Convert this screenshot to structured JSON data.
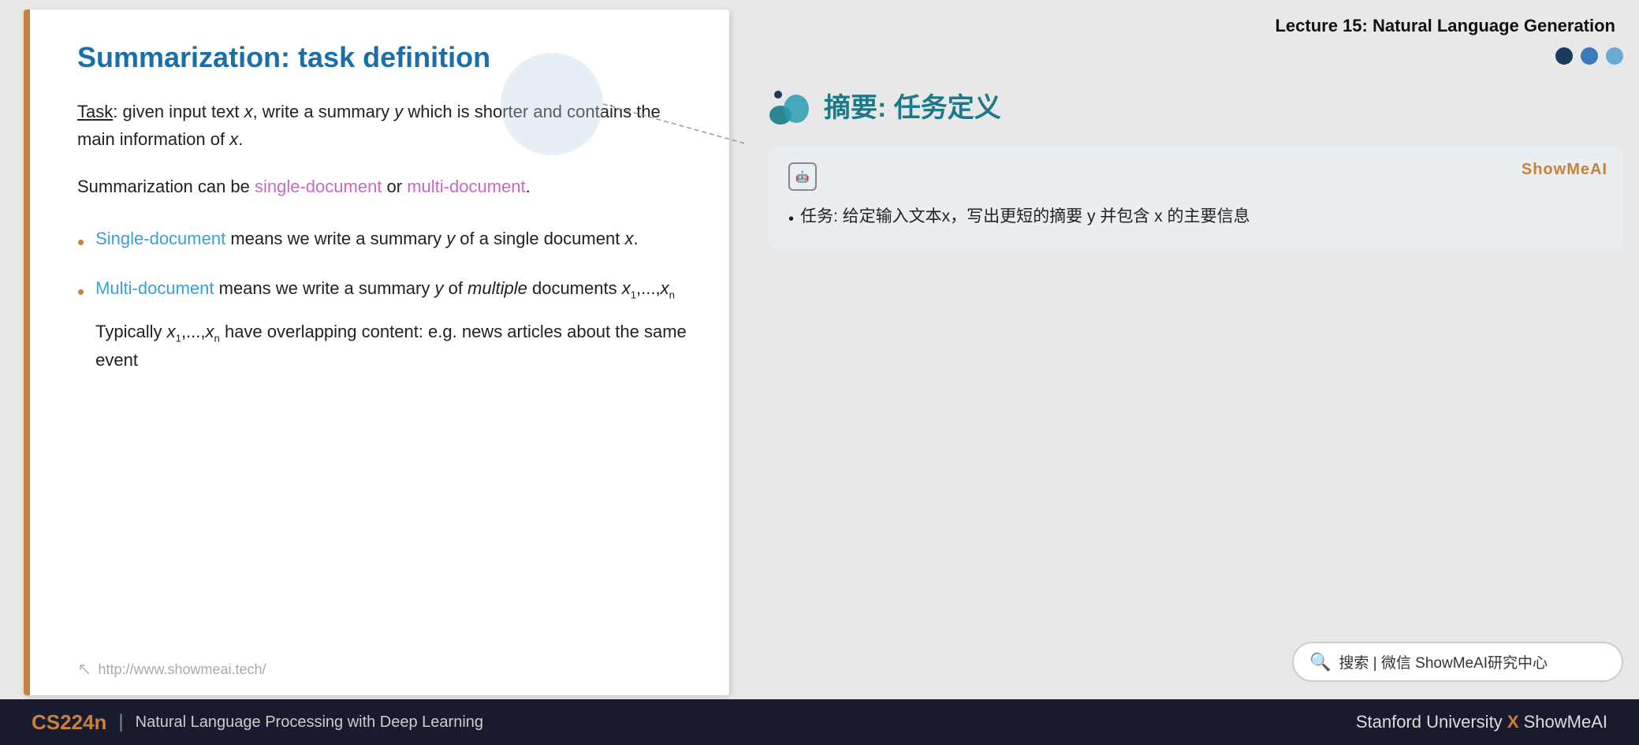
{
  "header": {
    "lecture_title": "Lecture 15: Natural Language Generation"
  },
  "slide": {
    "title": "Summarization: task definition",
    "border_color": "#C4823A",
    "task_line": "Task: given input text x, write a summary y which is shorter and contains the main information of x.",
    "can_be_line": "Summarization can be single-document or multi-document.",
    "single_doc_label": "single-document",
    "multi_doc_label": "multi-document",
    "bullets": [
      {
        "color_label": "Single-document",
        "text": " means we write a summary y of a single document x."
      },
      {
        "color_label": "Multi-document",
        "text": " means we write a summary y of multiple documents x"
      }
    ],
    "multi_sub": "1,...,x",
    "multi_sub2": "n",
    "typically_text": "Typically x",
    "typically_sub": "1,...,x",
    "typically_sub2": "n",
    "typically_end": " have overlapping content: e.g. news articles about the same event",
    "footer_url": "http://www.showmeai.tech/"
  },
  "right_panel": {
    "chinese_title": "摘要: 任务定义",
    "ai_box": {
      "badge": "AI",
      "brand": "ShowMeAI",
      "content": "• 任务: 给定输入文本x，写出更短的摘要 y 并包含 x 的主要信息"
    },
    "search_placeholder": "搜索 | 微信 ShowMeAI研究中心"
  },
  "nav_dots": {
    "dot1": "dark",
    "dot2": "active",
    "dot3": "light"
  },
  "bottom_bar": {
    "course_label": "CS224n",
    "divider": "|",
    "subtitle": "Natural Language Processing with Deep Learning",
    "right_text": "Stanford University",
    "x_symbol": "X",
    "brand": "ShowMeAI"
  }
}
